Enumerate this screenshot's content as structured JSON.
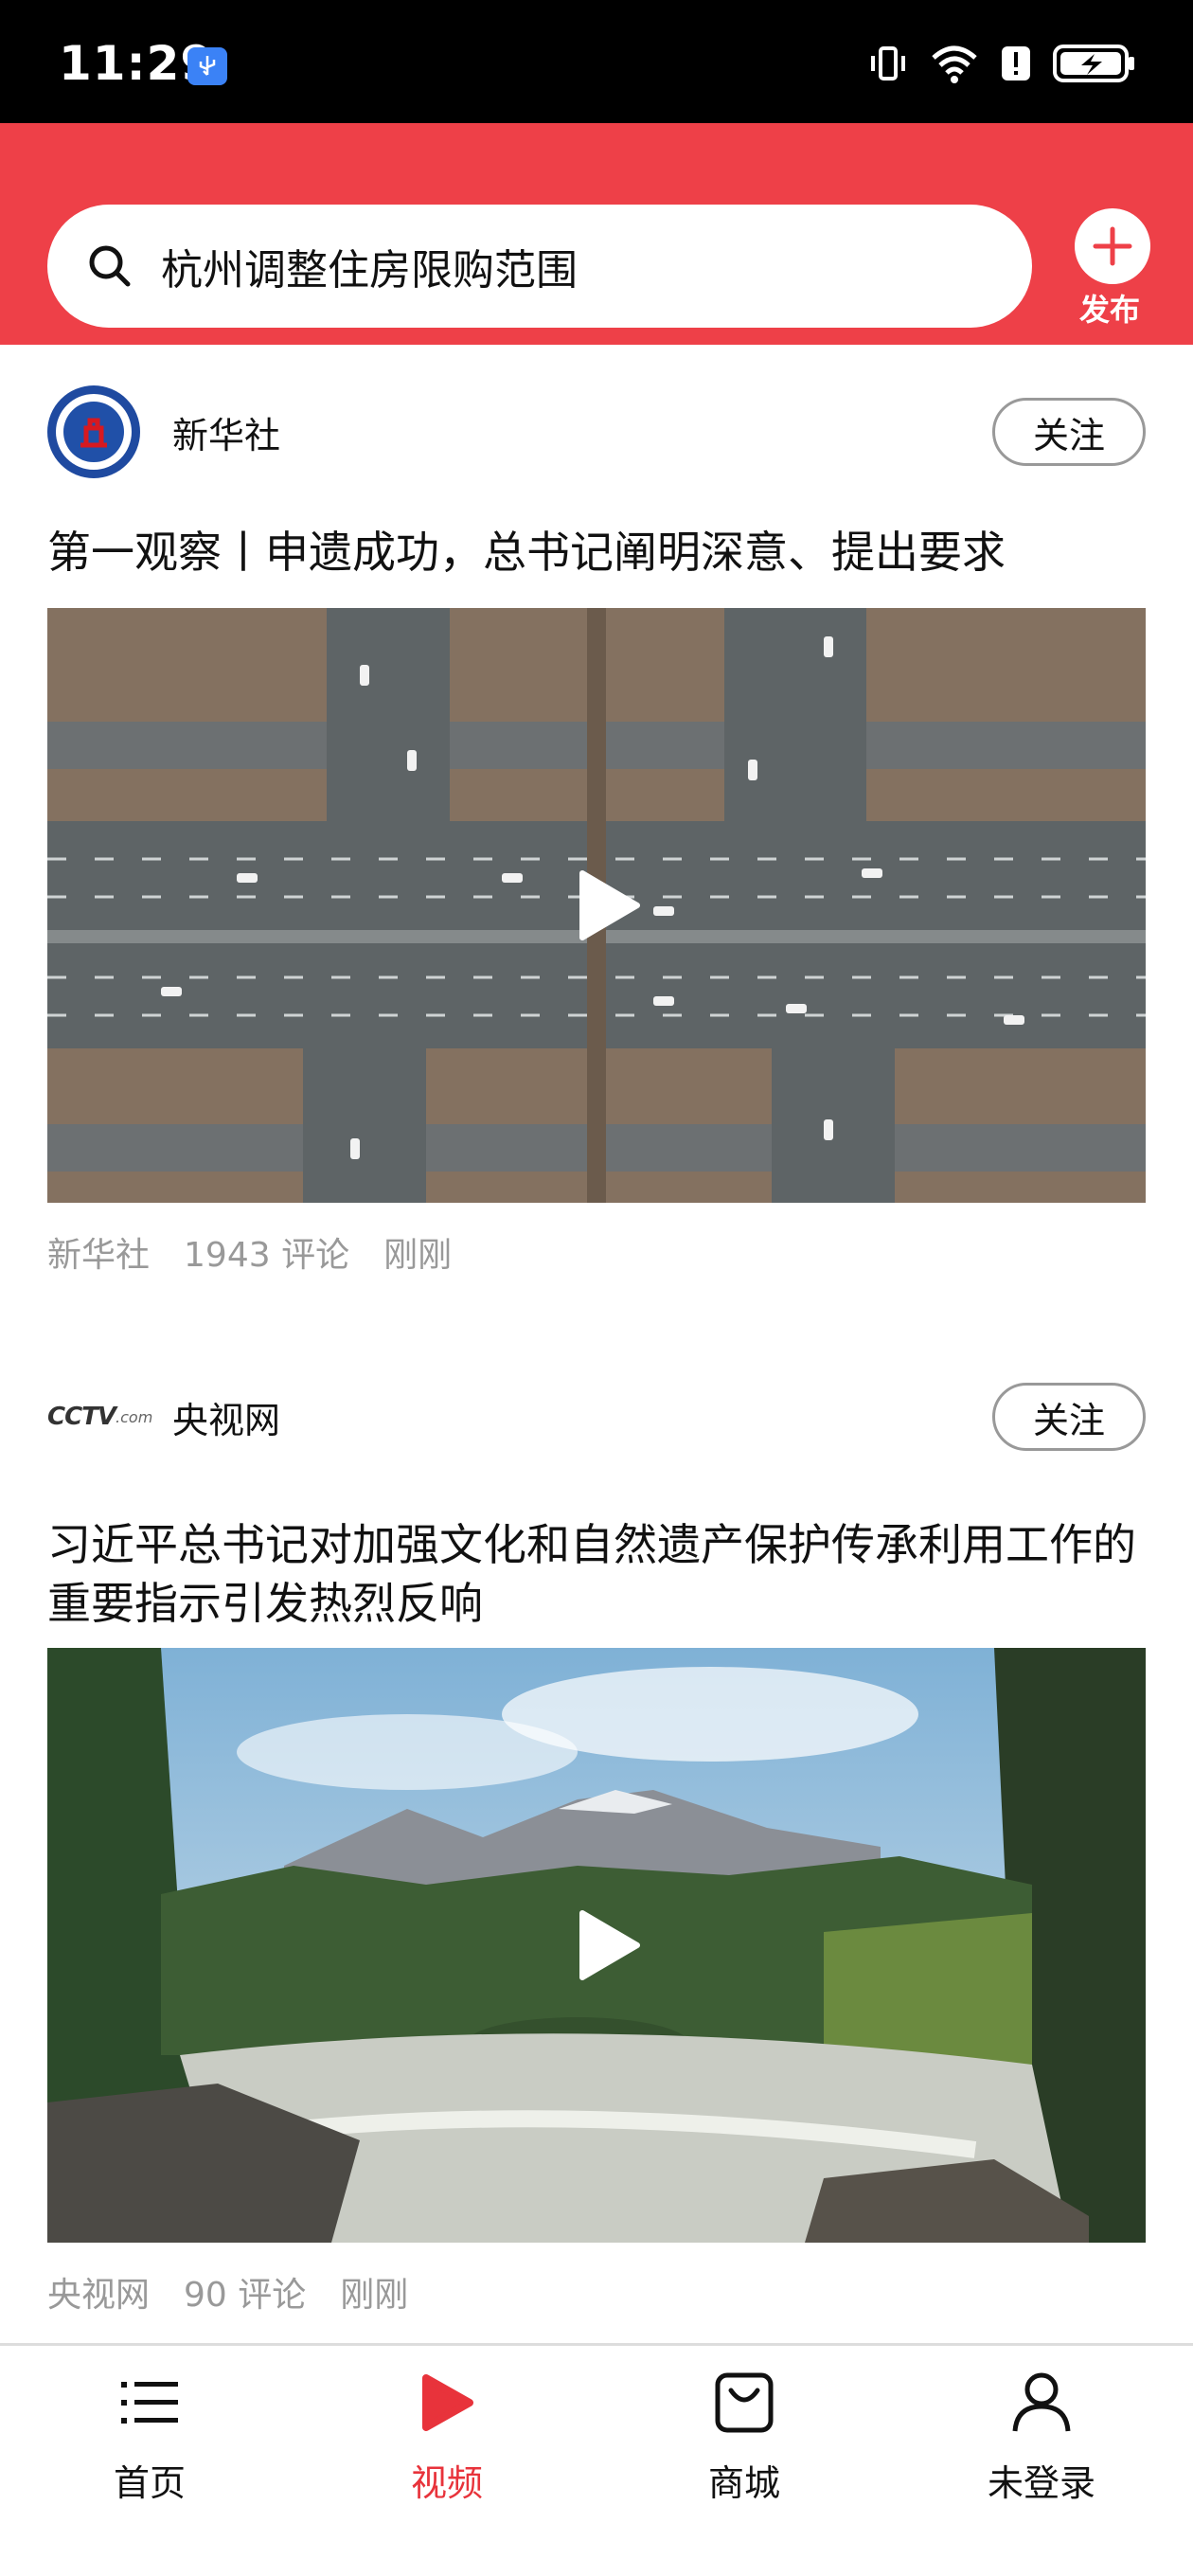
{
  "status_bar": {
    "time": "11:29",
    "battery_percent": 90
  },
  "header": {
    "search_text": "杭州调整住房限购范围",
    "publish_label": "发布",
    "accent_color": "#ee4048"
  },
  "feed": [
    {
      "source": "新华社",
      "follow_label": "关注",
      "title": "第一观察丨申遗成功，总书记阐明深意、提出要求",
      "meta": {
        "source": "新华社",
        "comments": "1943 评论",
        "time": "刚刚"
      },
      "media_icon": "play-icon"
    },
    {
      "source": "央视网",
      "follow_label": "关注",
      "title": "习近平总书记对加强文化和自然遗产保护传承利用工作的重要指示引发热烈反响",
      "meta": {
        "source": "央视网",
        "comments": "90 评论",
        "time": "刚刚"
      },
      "media_icon": "play-icon"
    }
  ],
  "bottom_nav": [
    {
      "label": "首页",
      "icon": "list-icon",
      "active": false
    },
    {
      "label": "视频",
      "icon": "video-play-icon",
      "active": true
    },
    {
      "label": "商城",
      "icon": "shopping-bag-icon",
      "active": false
    },
    {
      "label": "未登录",
      "icon": "user-icon",
      "active": false
    }
  ]
}
